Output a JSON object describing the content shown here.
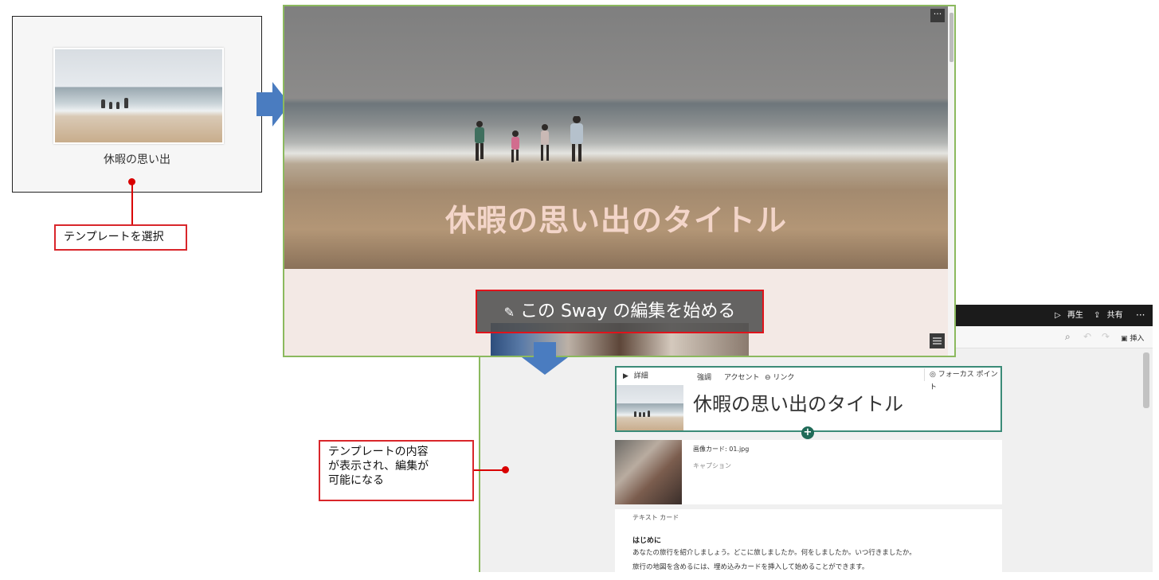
{
  "template": {
    "name": "休暇の思い出",
    "select_callout": "テンプレートを選択"
  },
  "preview": {
    "title": "休暇の思い出のタイトル",
    "edit_button_label": "この Sway の編集を始める",
    "more_label": "···"
  },
  "editor": {
    "play_label": "再生",
    "share_label": "共有",
    "more_label": "···",
    "insert_label": "挿入",
    "title_card": {
      "details_label": "詳細",
      "tabs": [
        "強調",
        "アクセント",
        "リンク"
      ],
      "focus_point_label": "フォーカス ポイント",
      "title": "休暇の思い出のタイトル"
    },
    "image_card": {
      "label": "画像カード: 01.jpg",
      "caption_placeholder": "キャプション"
    },
    "text_card": {
      "label": "テキスト カード",
      "heading": "はじめに",
      "line1": "あなたの旅行を紹介しましょう。どこに旅しましたか。何をしましたか。いつ行きましたか。",
      "line2": "旅行の地図を含めるには、埋め込みカードを挿入して始めることができます。"
    }
  },
  "content_callout": {
    "line1": "テンプレートの内容",
    "line2": "が表示され、編集が",
    "line3": "可能になる"
  },
  "colors": {
    "callout_red": "#d9262b",
    "arrow_blue": "#4a7cc0",
    "selection_green": "#3b8b78",
    "frame_green": "#8bb95e"
  }
}
